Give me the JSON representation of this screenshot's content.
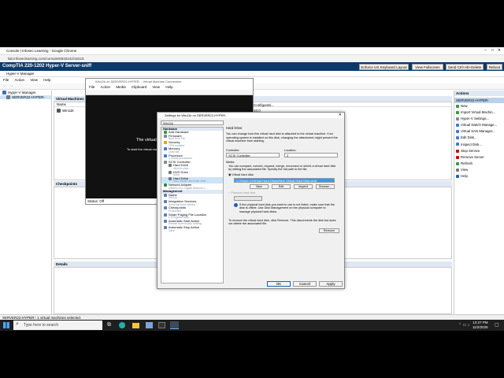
{
  "browser": {
    "title": "Console | Infosec Learning - Google Chrome",
    "url": "lab.infoseclearning.com/console/6632242/15315"
  },
  "lab_bar": {
    "title": "CompTIA 220-1202 Hyper-V Server-sniff",
    "buttons": [
      "Enforce US Keyboard Layout",
      "View Fullscreen",
      "Send Ctrl+Alt+Delete",
      "Reboot"
    ]
  },
  "hyperv": {
    "title": "Hyper-V Manager",
    "menu": [
      "File",
      "Action",
      "View",
      "Help"
    ],
    "tree_root": "Hyper-V Manager",
    "tree_server": "SERVER22-HYPER-",
    "vm_section": "Virtual Machines",
    "name_col": "Name",
    "vm_name": "Win11k",
    "config_col": "Configurati...",
    "config_rows": [
      "10.0",
      "10.0"
    ],
    "checkpoints": "Checkpoints",
    "details": "Details",
    "status": "SERVER22-HYPER-: 1 virtual machines selected."
  },
  "vmconnect": {
    "title": "Win11k on SERVER22-HYPER- - Virtual Machine Connection",
    "menu": [
      "File",
      "Action",
      "Media",
      "Clipboard",
      "View",
      "Help"
    ],
    "msg1": "The virtual m",
    "msg2": "To start the virtual mach",
    "status": "Status: Off"
  },
  "settings": {
    "title": "Settings for Win11k on SERVER22-HYPER-",
    "vm_select": "Win11k",
    "hardware_header": "Hardware",
    "hardware": [
      {
        "label": "Add Hardware",
        "sub": ""
      },
      {
        "label": "Firmware",
        "sub": "Boot from File"
      },
      {
        "label": "Security",
        "sub": "TPM enabled"
      },
      {
        "label": "Memory",
        "sub": "4096 MB"
      },
      {
        "label": "Processor",
        "sub": "2 Virtual processors"
      },
      {
        "label": "SCSI Controller",
        "sub": ""
      },
      {
        "label": "Hard Drive",
        "sub": "Win11k.vhdx"
      },
      {
        "label": "DVD Drive",
        "sub": "None"
      },
      {
        "label": "Hard Drive",
        "sub": "New Virtual Hard Disk.vhdx"
      },
      {
        "label": "Network Adapter",
        "sub": "Intel(R) I211 Gigabit Network C..."
      }
    ],
    "management_header": "Management",
    "management": [
      {
        "label": "Name",
        "sub": "Win11k"
      },
      {
        "label": "Integration Services",
        "sub": "Some services offered"
      },
      {
        "label": "Checkpoints",
        "sub": "Production"
      },
      {
        "label": "Smart Paging File Location",
        "sub": "C:\\ProgramData\\..."
      },
      {
        "label": "Automatic Start Action",
        "sub": "Restart if previously running"
      },
      {
        "label": "Automatic Stop Action",
        "sub": "Save"
      }
    ],
    "panel_title": "Hard Drive",
    "intro": "You can change how this virtual hard disk is attached to the virtual machine. If an operating system is installed on this disk, changing the attachment might prevent the virtual machine from starting.",
    "controller_label": "Controller:",
    "controller_value": "SCSI Controller",
    "location_label": "Location:",
    "location_value": "2",
    "media_label": "Media",
    "media_desc": "You can compact, convert, expand, merge, reconnect or shrink a virtual hard disk by editing the associated file. Specify the full path to the file.",
    "vhd_radio": "Virtual hard disk:",
    "vhd_path": "C:\\Hyper-V\\Virtual Hard Disks\\New Virtual Hard Disk.vhdx",
    "vhd_buttons": [
      "New",
      "Edit",
      "Inspect",
      "Browse..."
    ],
    "phys_radio": "Physical hard disk:",
    "note": "If the physical hard disk you want to use is not listed, make sure that the disk is offline. Use Disk Management on the physical computer to manage physical hard disks.",
    "remove_desc": "To remove the virtual hard disk, click Remove. This disconnects the disk but does not delete the associated file.",
    "remove_btn": "Remove",
    "ok": "OK",
    "cancel": "Cancel",
    "apply": "Apply"
  },
  "actions": {
    "header": "Actions",
    "server": "SERVER22-HYPER-",
    "items": [
      "New",
      "Import Virtual Machin...",
      "Hyper-V Settings...",
      "Virtual Switch Manage...",
      "Virtual SAN Manager...",
      "Edit Disk...",
      "Inspect Disk...",
      "Stop Service",
      "Remove Server",
      "Refresh",
      "View",
      "Help"
    ]
  },
  "taskbar": {
    "search_placeholder": "Type here to search",
    "time": "12:27 PM",
    "date": "11/2/2025"
  },
  "colors": {
    "accent": "#0b3a6b",
    "selection": "#3399ff"
  }
}
